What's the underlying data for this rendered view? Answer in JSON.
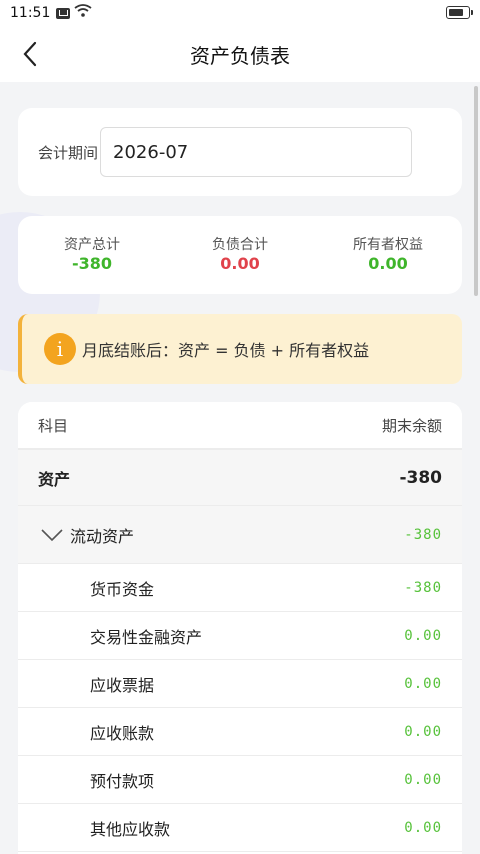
{
  "status": {
    "time": "11:51"
  },
  "nav": {
    "title": "资产负债表"
  },
  "period": {
    "label": "会计期间",
    "value": "2026-07"
  },
  "summary": [
    {
      "label": "资产总计",
      "value": "-380",
      "color": "#3fb52b"
    },
    {
      "label": "负债合计",
      "value": "0.00",
      "color": "#e0424b"
    },
    {
      "label": "所有者权益",
      "value": "0.00",
      "color": "#3fb52b"
    }
  ],
  "notice": {
    "icon": "info-icon",
    "text": "月底结账后：资产 = 负债 + 所有者权益"
  },
  "table": {
    "col_subject": "科目",
    "col_balance": "期末余额",
    "group": {
      "name": "资产",
      "value": "-380"
    },
    "subgroup": {
      "name": "流动资产",
      "value": "-380"
    },
    "rows": [
      {
        "name": "货币资金",
        "value": "-380"
      },
      {
        "name": "交易性金融资产",
        "value": "0.00"
      },
      {
        "name": "应收票据",
        "value": "0.00"
      },
      {
        "name": "应收账款",
        "value": "0.00"
      },
      {
        "name": "预付款项",
        "value": "0.00"
      },
      {
        "name": "其他应收款",
        "value": "0.00"
      }
    ]
  }
}
